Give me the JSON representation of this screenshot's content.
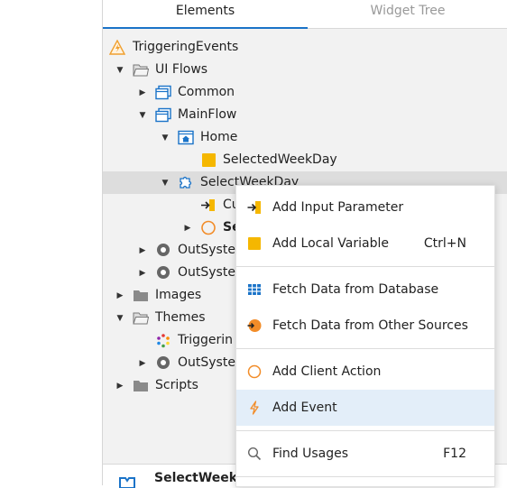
{
  "tabs": {
    "elements": "Elements",
    "widget_tree": "Widget Tree"
  },
  "tree": {
    "root": "TriggeringEvents",
    "ui_flows": "UI Flows",
    "common": "Common",
    "mainflow": "MainFlow",
    "home": "Home",
    "selected_weekday_var": "SelectedWeekDay",
    "selectweekday_block": "SelectWeekDay",
    "child_input": "Cu",
    "child_action": "Se",
    "outsystems_1": "OutSyste",
    "outsystems_2": "OutSyste",
    "images": "Images",
    "themes": "Themes",
    "theme_item": "Triggerin",
    "outsystems_3": "OutSyste",
    "scripts": "Scripts"
  },
  "bottom": {
    "title": "SelectWeekD"
  },
  "menu": {
    "add_input_parameter": "Add Input Parameter",
    "add_local_variable": "Add Local Variable",
    "add_local_variable_shortcut": "Ctrl+N",
    "fetch_data_db": "Fetch Data from Database",
    "fetch_data_other": "Fetch Data from Other Sources",
    "add_client_action": "Add Client Action",
    "add_event": "Add Event",
    "find_usages": "Find Usages",
    "find_usages_shortcut": "F12"
  },
  "colors": {
    "accent": "#1a73c8",
    "warning": "#f0a030",
    "orange": "#f28c28",
    "highlight_row": "#dddddd",
    "menu_hover": "#e3eef9"
  }
}
